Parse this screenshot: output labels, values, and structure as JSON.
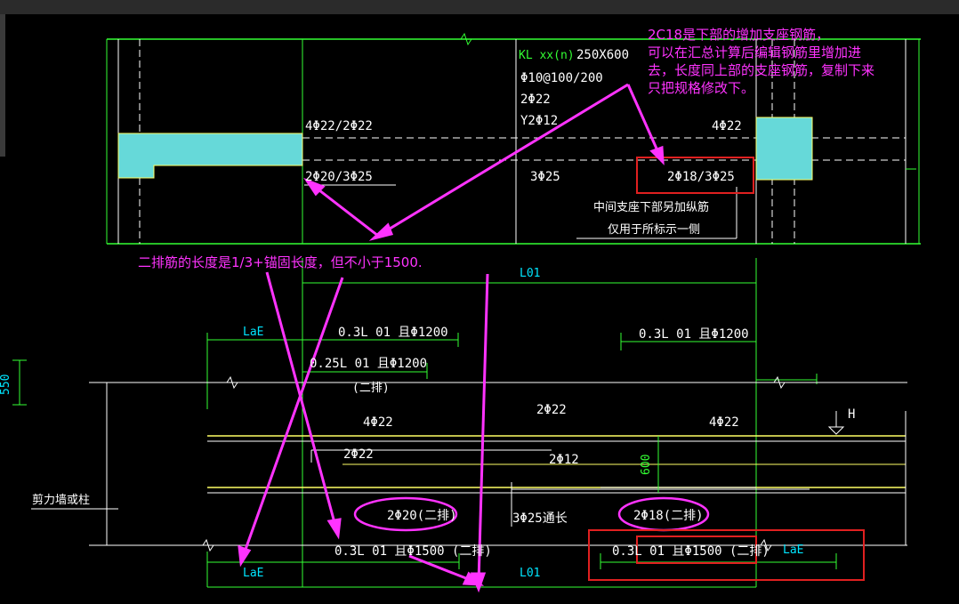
{
  "window": {
    "chrome": "dark"
  },
  "annotations": {
    "top_right_line1": "2C18是下部的增加支座钢筋，",
    "top_right_line2": "可以在汇总计算后编辑钢筋里增加进",
    "top_right_line3": "去，长度同上部的支座钢筋，复制下来",
    "top_right_line4": "只把规格修改下。",
    "second_row_note": "二排筋的长度是1/3+锚固长度，但不小于1500."
  },
  "beam_label": {
    "kl": "KL xx(n)",
    "size": "250X600",
    "stirrup": "Φ10@100/200",
    "top": "2Φ22",
    "side": "Y2Φ12"
  },
  "top_section": {
    "left_top": "4Φ22/2Φ22",
    "left_bottom": "2Φ20/3Φ25",
    "mid_bottom": "3Φ25",
    "right_top": "4Φ22",
    "right_bottom": "2Φ18/3Φ25",
    "note1": "中间支座下部另加纵筋",
    "note2": "仅用于所标示一侧"
  },
  "bottom_section": {
    "l01_top": "L01",
    "l01_bottom": "L01",
    "lae_left": "LaE",
    "lae_bottom_left": "LaE",
    "lae_bottom_right": "LaE",
    "dim_left_top": "0.3L 01 且Φ1200",
    "dim_left_second": "0.25L 01 且Φ1200",
    "second_row_tag": "(二排)",
    "dim_right_top": "0.3L 01 且Φ1200",
    "top_bars": "4Φ22",
    "top_bars_right": "4Φ22",
    "mid_top": "2Φ22",
    "erect": "2Φ22",
    "side_bars": "2Φ12",
    "depth": "600",
    "level_mark": "H",
    "bottom_left_second": "2Φ20(二排)",
    "bottom_through": "3Φ25通长",
    "bottom_right_second": "2Φ18(二排)",
    "dim_bottom_left": "0.3L 01 且Φ1500 (二排)",
    "dim_bottom_right": "0.3L 01 且Φ1500 (二排)",
    "wall_label": "剪力墙或柱",
    "left_dim": "550"
  },
  "colors": {
    "accent": "#ff33ff",
    "highlight": "#e02020",
    "concrete": "#66d9d9",
    "dimension": "#33ff33"
  }
}
